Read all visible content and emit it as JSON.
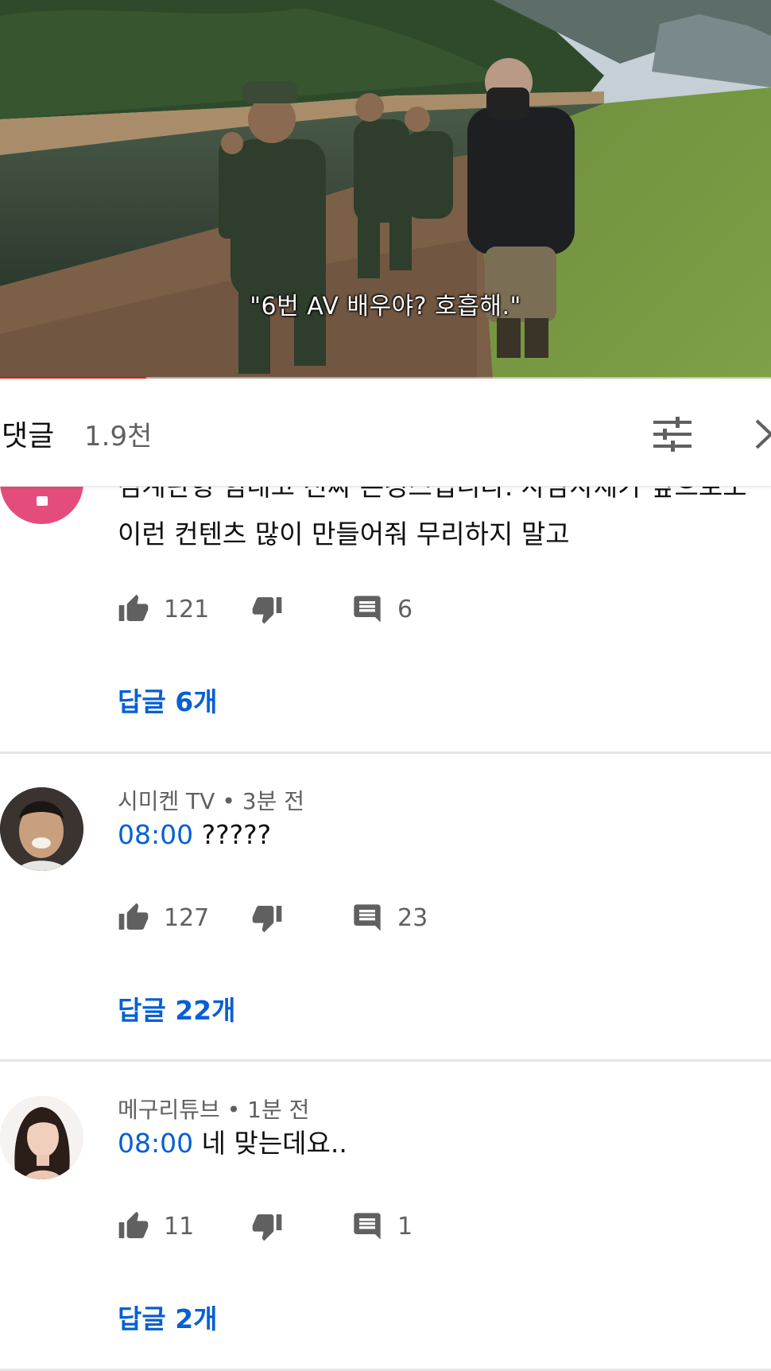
{
  "video": {
    "subtitle": "\"6번 AV 배우야? 호흡해.\"",
    "progress_percent": 19
  },
  "comments_header": {
    "title": "댓글",
    "count": "1.9천",
    "sort_icon": "sort-filter-icon",
    "close_icon": "close-icon"
  },
  "comments": [
    {
      "avatar_color": "#e44d7b",
      "body_partial": "김계란형 힘내고 진짜 존경스럽니다. 사담사제가 앞으로도",
      "body": "이런 컨텐츠 많이 만들어줘 무리하지 말고",
      "likes": "121",
      "reply_count": "6",
      "replies_label": "답글 6개"
    },
    {
      "author": "시미켄 TV",
      "time": "3분 전",
      "timestamp": "08:00",
      "text": "?????",
      "likes": "127",
      "reply_count": "23",
      "replies_label": "답글 22개"
    },
    {
      "author": "메구리튜브",
      "time": "1분 전",
      "timestamp": "08:00",
      "text": "네 맞는데요..",
      "likes": "11",
      "reply_count": "1",
      "replies_label": "답글 2개"
    }
  ],
  "colors": {
    "link_blue": "#065fd4",
    "secondary_text": "#606060",
    "progress_red": "#ff0000"
  },
  "icons": [
    "like-icon",
    "dislike-icon",
    "reply-icon"
  ]
}
